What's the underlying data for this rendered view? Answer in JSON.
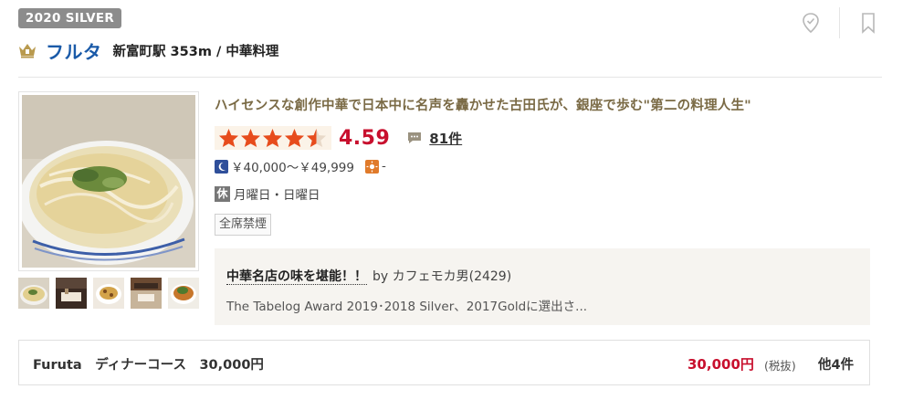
{
  "award_badge": "2020 SILVER",
  "restaurant": {
    "name": "フルタ",
    "area_genre": "新富町駅 353m / 中華料理"
  },
  "catch_copy": "ハイセンスな創作中華で日本中に名声を轟かせた古田氏が、銀座で歩む\"第二の料理人生\"",
  "rating": {
    "score": "4.59",
    "stars": 4.5,
    "review_count": "81件"
  },
  "price": {
    "dinner": "￥40,000～￥49,999",
    "lunch": "-"
  },
  "holiday": {
    "icon_label": "休",
    "days": "月曜日・日曜日"
  },
  "tag": "全席禁煙",
  "review": {
    "title": "中華名店の味を堪能！！",
    "by": "by カフェモカ男(2429)",
    "excerpt": "The Tabelog Award 2019･2018 Silver、2017Goldに選出さ..."
  },
  "course": {
    "name": "Furuta　ディナーコース　30,000円",
    "price": "30,000円",
    "tax": "(税抜)",
    "more": "他4件"
  },
  "colors": {
    "score_red": "#c8102e",
    "name_blue": "#1a5aa8",
    "star_orange": "#e74c1c",
    "badge_gray": "#8c8c8c"
  },
  "icons": [
    "pin-check-icon",
    "bookmark-icon",
    "crown-icon",
    "speech-bubble-icon",
    "moon-icon",
    "sun-icon"
  ]
}
